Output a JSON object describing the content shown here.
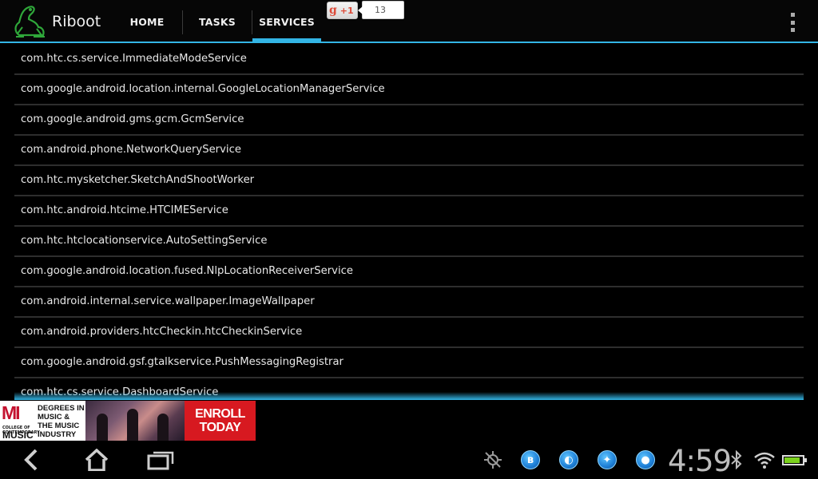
{
  "app": {
    "title": "Riboot",
    "logo_icon": "frog-logo-icon"
  },
  "tabs": [
    {
      "label": "HOME",
      "active": false
    },
    {
      "label": "TASKS",
      "active": false
    },
    {
      "label": "SERVICES",
      "active": true
    }
  ],
  "gplus": {
    "label": "+1",
    "count": "13"
  },
  "services": [
    "com.htc.cs.service.ImmediateModeService",
    "com.google.android.location.internal.GoogleLocationManagerService",
    "com.google.android.gms.gcm.GcmService",
    "com.android.phone.NetworkQueryService",
    "com.htc.mysketcher.SketchAndShootWorker",
    "com.htc.android.htcime.HTCIMEService",
    "com.htc.htclocationservice.AutoSettingService",
    "com.google.android.location.fused.NlpLocationReceiverService",
    "com.android.internal.service.wallpaper.ImageWallpaper",
    "com.android.providers.htcCheckin.htcCheckinService",
    "com.google.android.gsf.gtalkservice.PushMessagingRegistrar",
    "com.htc.cs.service.DashboardService"
  ],
  "ad": {
    "logo_text": "MI",
    "college_text": "COLLEGE OF CONTEMPORARY",
    "music_text": "MUSIC",
    "line1": "DEGREES IN",
    "line2": "MUSIC &",
    "line3": "THE MUSIC",
    "line4": "INDUSTRY",
    "cta1": "ENROLL",
    "cta2": "TODAY"
  },
  "status": {
    "time": "4:59",
    "battery_level": 0.85,
    "accent": "#33b5e5"
  }
}
